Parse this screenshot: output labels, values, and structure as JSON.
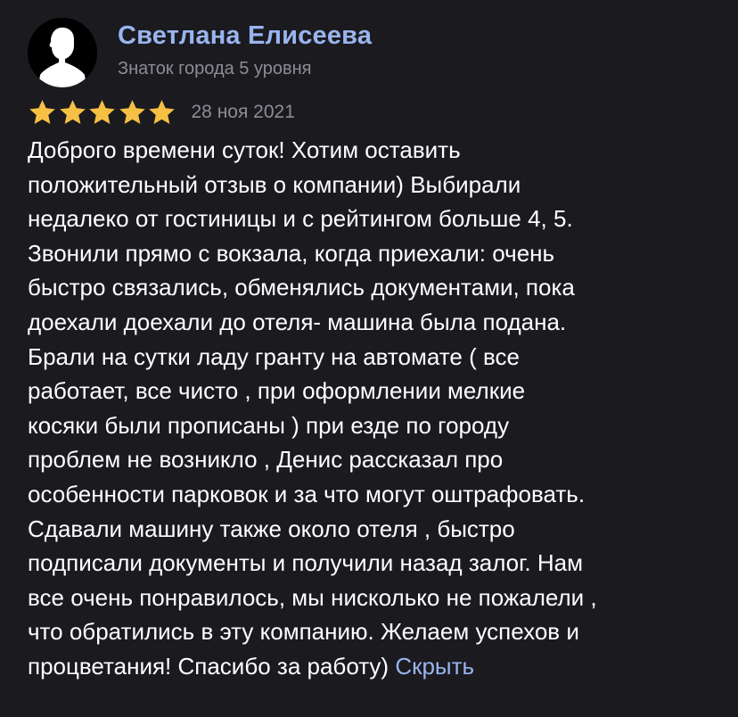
{
  "review": {
    "author": {
      "name": "Светлана Елисеева",
      "level": "Знаток города 5 уровня",
      "avatar_icon": "user-silhouette-icon"
    },
    "rating": {
      "value": 5,
      "max": 5,
      "star_color": "#f6c044"
    },
    "date": "28 ноя 2021",
    "text_lines": [
      "Доброго времени суток! Хотим оставить",
      "положительный отзыв о компании) Выбирали",
      "недалеко от гостиницы и с рейтингом больше 4, 5.",
      "Звонили прямо с вокзала, когда приехали: очень",
      "быстро связались, обменялись документами, пока",
      "доехали доехали до отеля- машина была подана.",
      "Брали на сутки ладу гранту на автомате ( все",
      "работает, все чисто , при оформлении мелкие",
      "косяки были прописаны ) при езде по городу",
      "проблем не возникло , Денис рассказал про",
      "особенности парковок и за что могут оштрафовать.",
      "Сдавали машину также около отеля , быстро",
      "подписали документы и получили назад залог. Нам",
      "все очень понравилось, мы нисколько не пожалели ,",
      "что обратились в эту компанию. Желаем успехов и",
      "процветания! Спасибо за работу)"
    ],
    "hide_label": "Скрыть"
  },
  "colors": {
    "background": "#1b1a1f",
    "accent": "#99b5ef",
    "secondary_text": "#8e8c94"
  }
}
